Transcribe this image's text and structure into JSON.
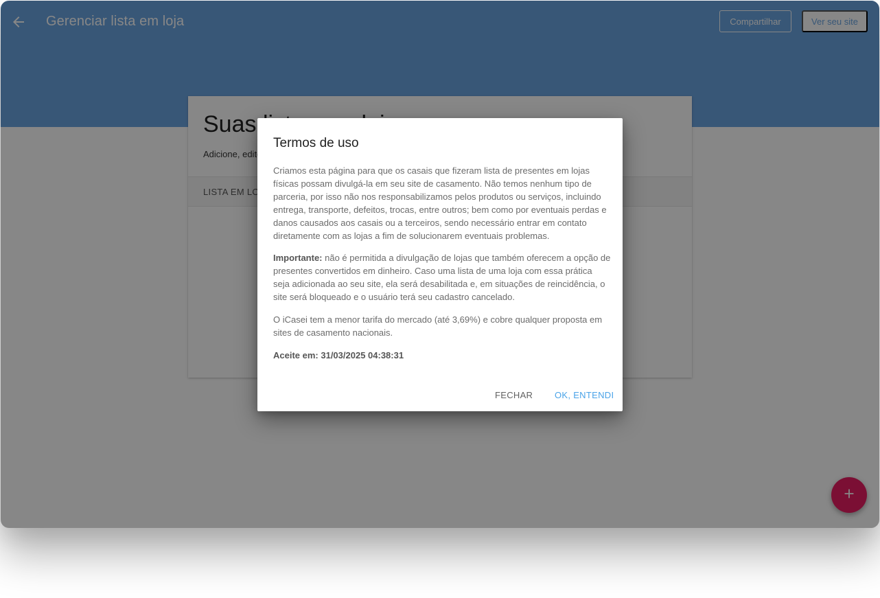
{
  "header": {
    "title": "Gerenciar lista em loja",
    "share_label": "Compartilhar",
    "view_site_label": "Ver seu site",
    "back_icon": "arrow-left-icon"
  },
  "card": {
    "heading": "Suas listas em lojas",
    "description": "Adicione, edite ou remova as listas de presentes em lojas físicas.",
    "column_header": "LISTA EM LOJA"
  },
  "fab": {
    "icon": "plus-icon",
    "label": "+"
  },
  "dialog": {
    "title": "Termos de uso",
    "paragraph1": "Criamos esta página para que os casais que fizeram lista de presentes em lojas físicas possam divulgá-la em seu site de casamento. Não temos nenhum tipo de parceria, por isso não nos responsabilizamos pelos produtos ou serviços, incluindo entrega, transporte, defeitos, trocas, entre outros; bem como por eventuais perdas e danos causados aos casais ou a terceiros, sendo necessário entrar em contato diretamente com as lojas a fim de solucionarem eventuais problemas.",
    "important_label": "Importante:",
    "paragraph2": " não é permitida a divulgação de lojas que também oferecem a opção de presentes convertidos em dinheiro. Caso uma lista de uma loja com essa prática seja adicionada ao seu site, ela será desabilitada e, em situações de reincidência, o site será bloqueado e o usuário terá seu cadastro cancelado.",
    "paragraph3": "O iCasei tem a menor tarifa do mercado (até 3,69%) e cobre qualquer proposta em sites de casamento nacionais.",
    "accepted": "Aceite em: 31/03/2025 04:38:31",
    "close_label": "FECHAR",
    "ok_label": "OK, ENTENDI"
  },
  "colors": {
    "header": "#6aa4e0",
    "fab": "#e91e63",
    "primary_action": "#4aa3e8"
  }
}
